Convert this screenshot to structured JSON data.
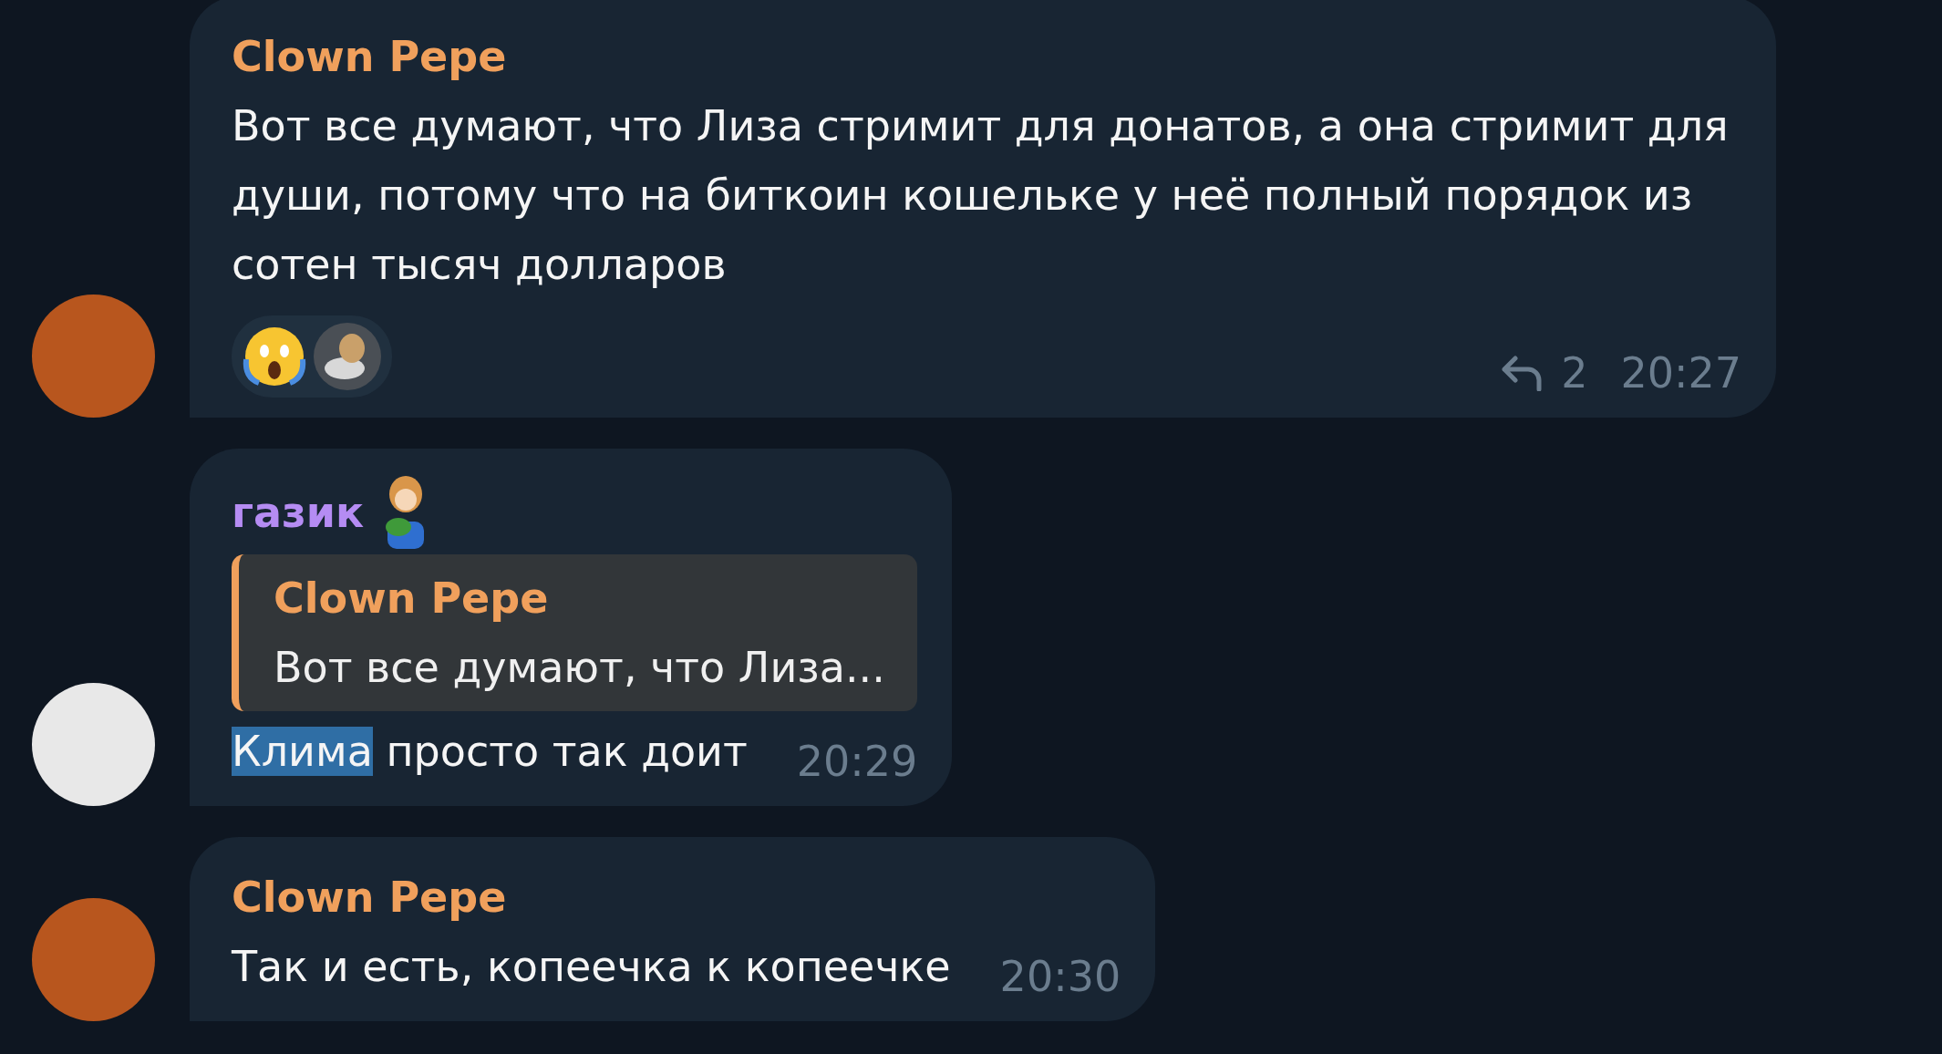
{
  "messages": [
    {
      "sender": "Clown Pepe",
      "color": "#f0a05c",
      "avatar": {
        "color": "#b8561e"
      },
      "text": [
        {
          "text": "Вот все думают, что Лиза стримит для донатов, а она стримит для души, потому что на биткоин кошельке у неё полный порядок из сотен тысяч долларов",
          "selected": false
        }
      ],
      "reactions": [
        {
          "kind": "emoji"
        },
        {
          "kind": "sticker"
        }
      ],
      "reply_count": "2",
      "time": "20:27"
    },
    {
      "sender": "газик",
      "color": "#b58cf3",
      "sender_sticker": true,
      "avatar": {
        "color": "#e8e8e8"
      },
      "quote": {
        "sender": "Clown Pepe",
        "text": "Вот все думают, что Лиза..."
      },
      "text": [
        {
          "text": "Клима",
          "selected": true
        },
        {
          "text": " просто так доит",
          "selected": false
        }
      ],
      "time": "20:29"
    },
    {
      "sender": "Clown Pepe",
      "color": "#f0a05c",
      "avatar": {
        "color": "#b8561e"
      },
      "text": [
        {
          "text": "Так и есть, копеечка к копеечке",
          "selected": false
        }
      ],
      "time": "20:30"
    }
  ]
}
